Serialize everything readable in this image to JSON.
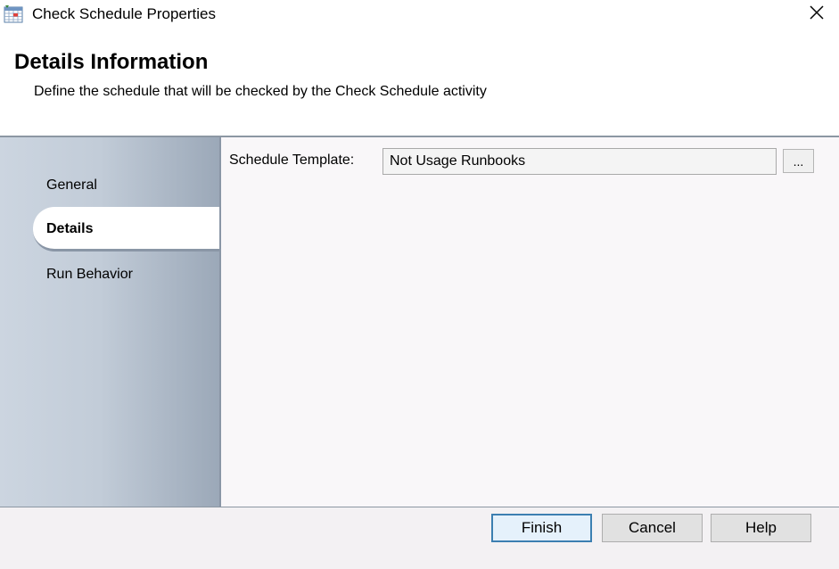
{
  "window": {
    "title": "Check Schedule Properties",
    "icon": "calendar-icon",
    "close_icon": "close-icon"
  },
  "header": {
    "title": "Details Information",
    "description": "Define the schedule that will be checked by the Check Schedule activity"
  },
  "sidebar": {
    "items": [
      {
        "label": "General",
        "active": false
      },
      {
        "label": "Details",
        "active": true
      },
      {
        "label": "Run Behavior",
        "active": false
      }
    ]
  },
  "details": {
    "schedule_template_label": "Schedule Template:",
    "schedule_template_value": "Not Usage Runbooks",
    "browse_label": "..."
  },
  "footer": {
    "finish_label": "Finish",
    "cancel_label": "Cancel",
    "help_label": "Help"
  },
  "colors": {
    "accent": "#3c7fb1",
    "sidebar": "#c2ccd8",
    "content_bg": "#f9f7f9"
  }
}
